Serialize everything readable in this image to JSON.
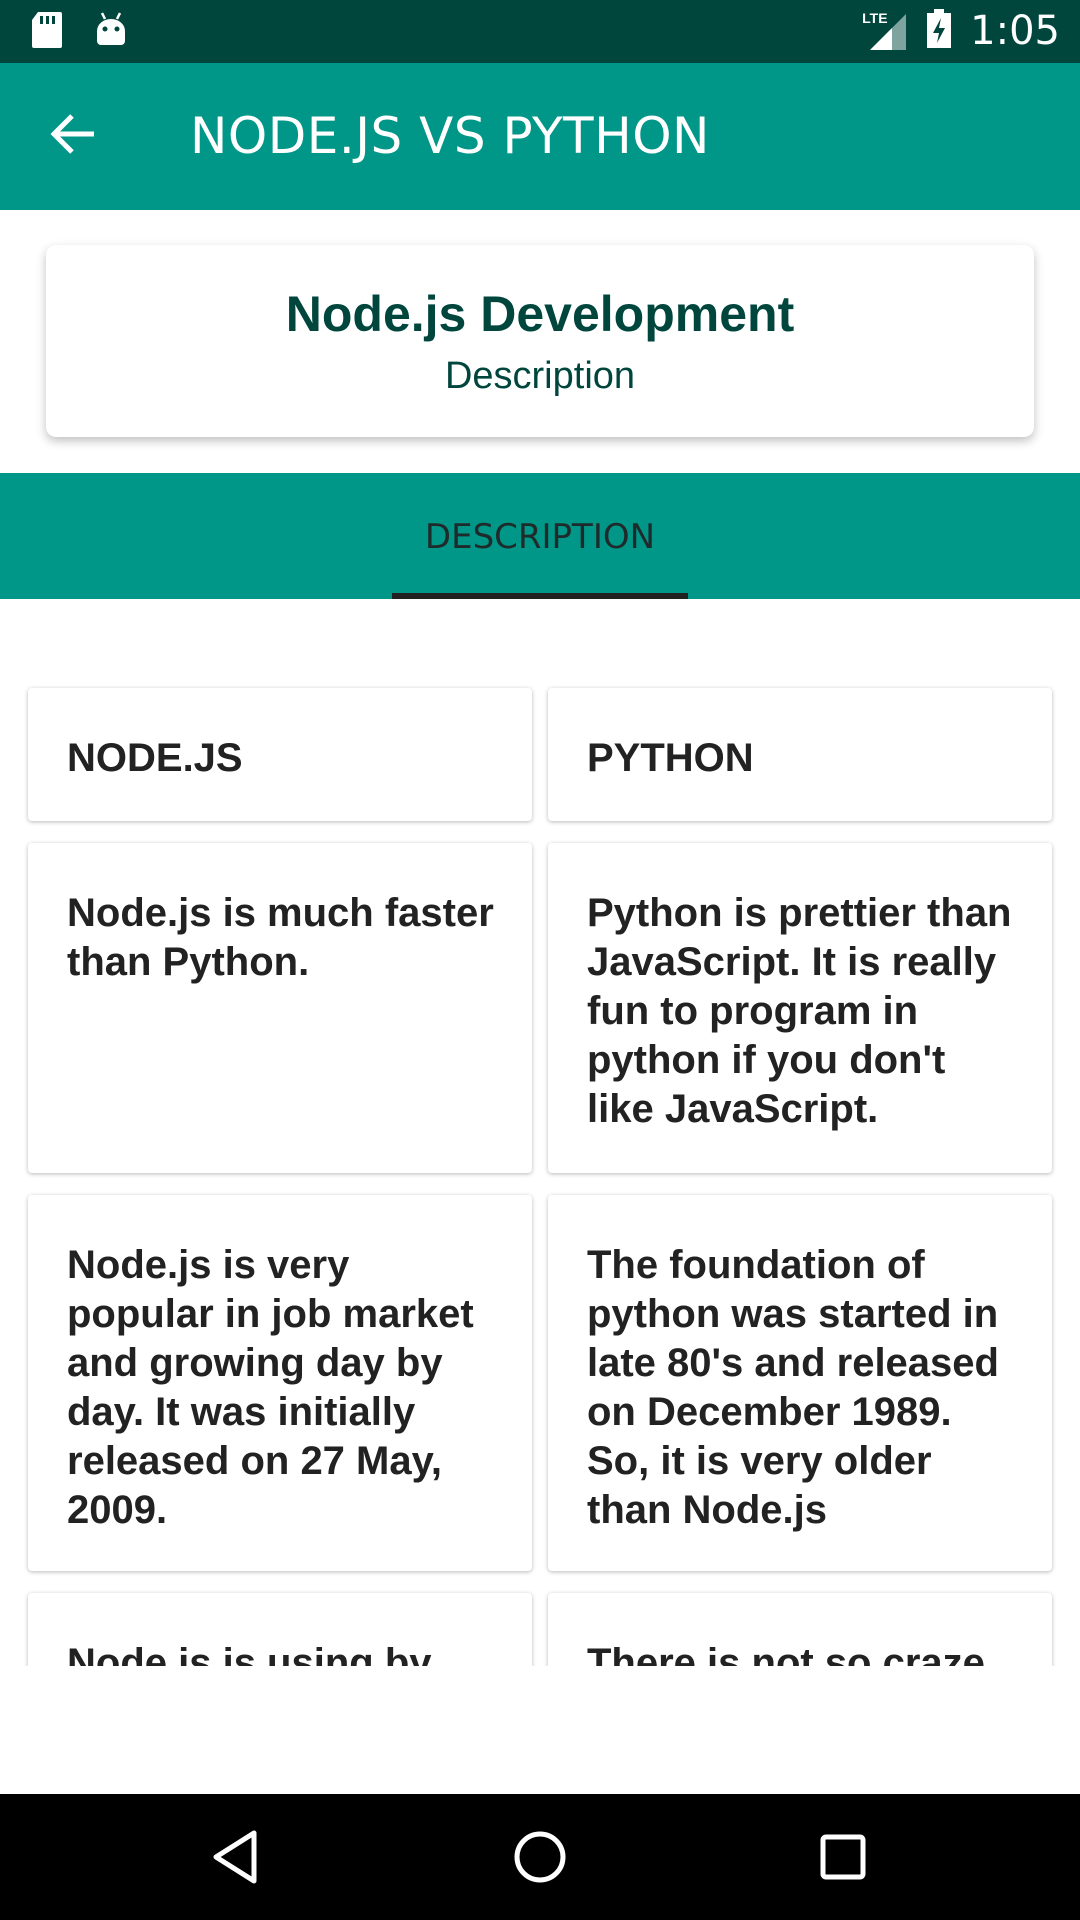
{
  "status_bar": {
    "time": "1:05",
    "network_label": "LTE",
    "icons": [
      "sd-card-icon",
      "android-icon",
      "signal-icon",
      "battery-icon"
    ]
  },
  "app_bar": {
    "title": "NODE.JS VS PYTHON",
    "back_icon": "arrow-back-icon"
  },
  "header_card": {
    "title": "Node.js Development",
    "subtitle": "Description"
  },
  "tabs": [
    {
      "label": "DESCRIPTION",
      "selected": true
    }
  ],
  "comparison": {
    "headers": [
      "NODE.JS",
      "PYTHON"
    ],
    "rows": [
      {
        "nodejs": "Node.js is much faster than Python.",
        "python": "Python is prettier than JavaScript. It is really fun to program in python if you don't like JavaScript."
      },
      {
        "nodejs": "Node.js is very popular in job market and growing day by day. It was initially released on 27 May, 2009.",
        "python": "The foundation of python was started in late 80's and released on December 1989. So, it is very older than Node.js"
      },
      {
        "nodejs": "Node.js is using by",
        "python": "There is not so craze"
      }
    ]
  },
  "nav_bar": {
    "back": "nav-back-icon",
    "home": "nav-home-icon",
    "recents": "nav-recents-icon"
  },
  "colors": {
    "primary": "#009688",
    "primary_dark": "#00463d",
    "card_title": "#00463d",
    "tab_indicator": "#212121"
  }
}
